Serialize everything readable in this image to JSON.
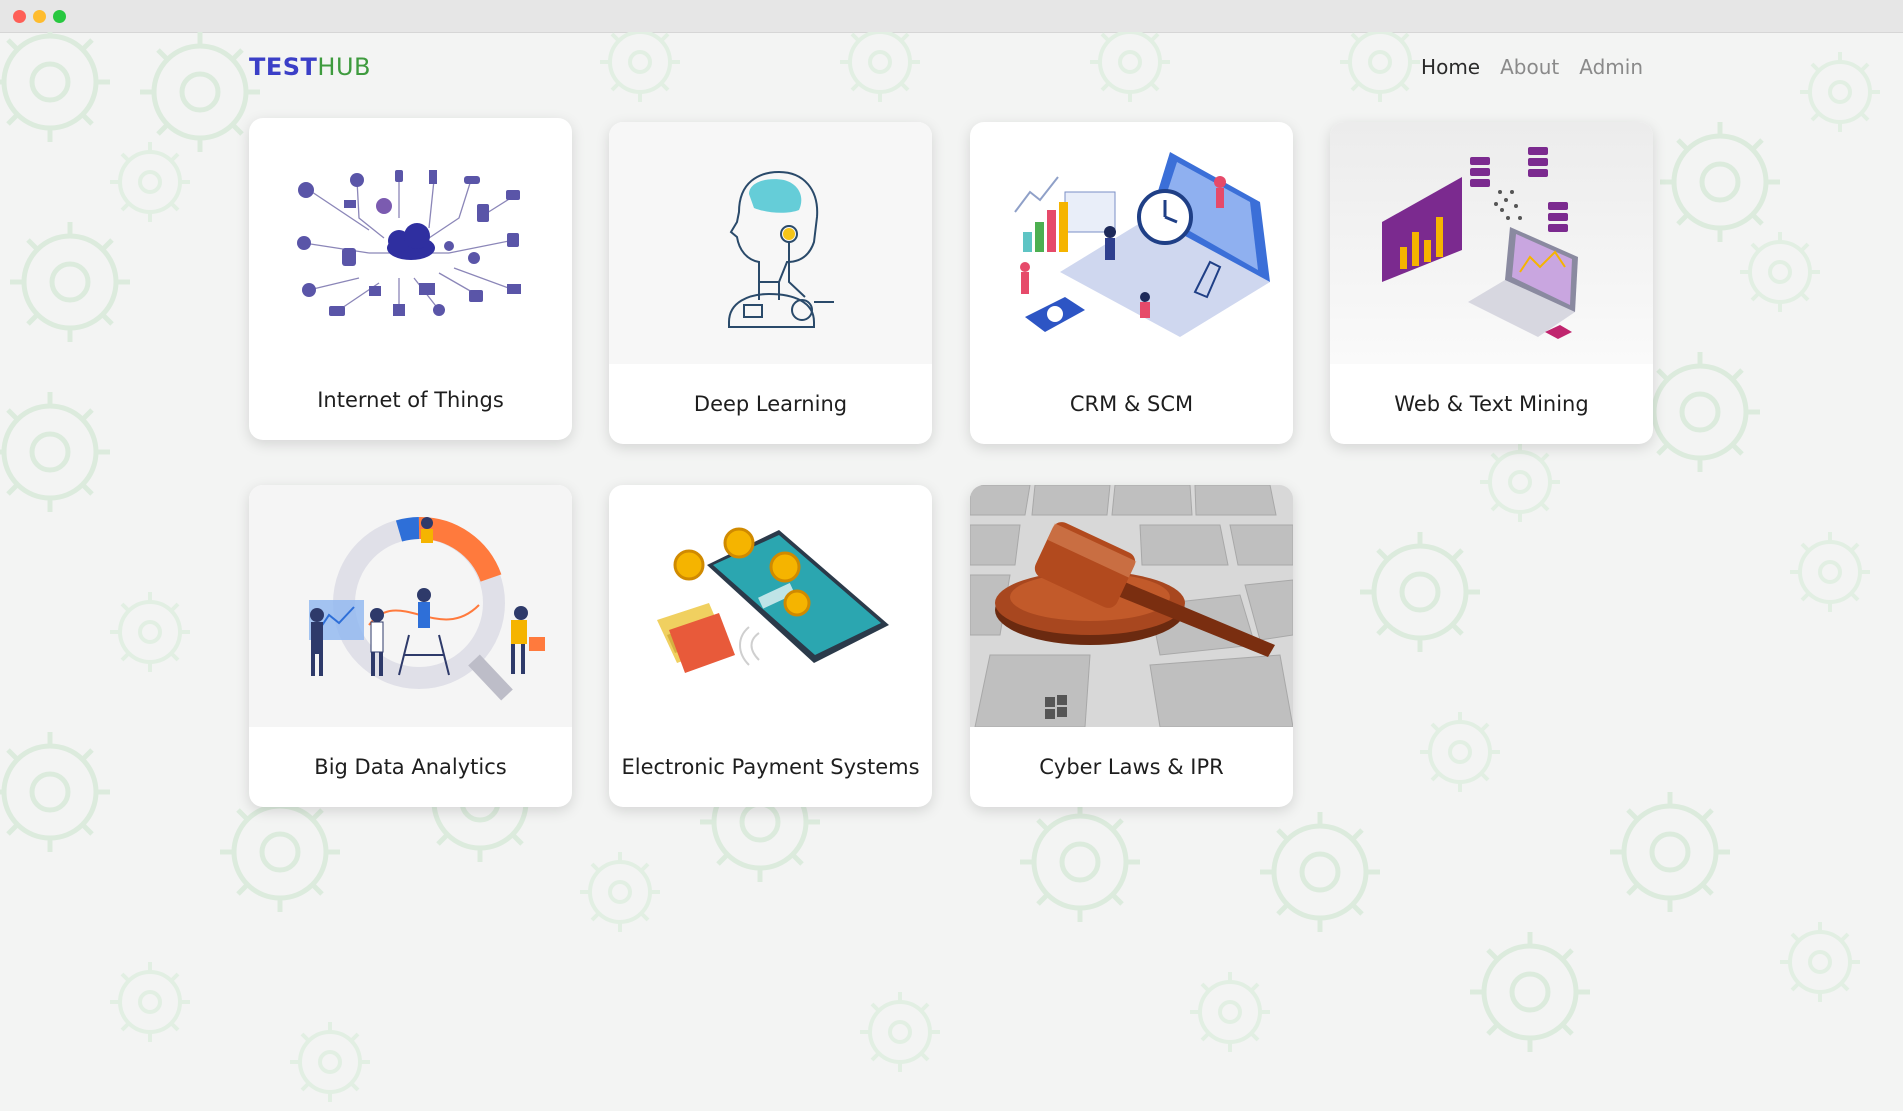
{
  "brand": {
    "part1": "TEST",
    "part2": "HUB"
  },
  "nav": {
    "home": "Home",
    "about": "About",
    "admin": "Admin"
  },
  "cards": [
    {
      "label": "Internet of Things"
    },
    {
      "label": "Deep Learning"
    },
    {
      "label": "CRM & SCM"
    },
    {
      "label": "Web & Text Mining"
    },
    {
      "label": "Big Data Analytics"
    },
    {
      "label": "Electronic Payment Systems"
    },
    {
      "label": "Cyber Laws & IPR"
    }
  ],
  "icons": {
    "card1": "iot-network-icon",
    "card2": "robot-head-icon",
    "card3": "laptop-clock-icon",
    "card4": "data-mining-icon",
    "card5": "analytics-team-icon",
    "card6": "mobile-payment-icon",
    "card7": "gavel-keyboard-icon"
  },
  "colors": {
    "brand_blue": "#3b3fc7",
    "brand_green": "#3e9b3e",
    "nav_active": "#2b2b2b",
    "nav_inactive": "#8a8a8a"
  }
}
